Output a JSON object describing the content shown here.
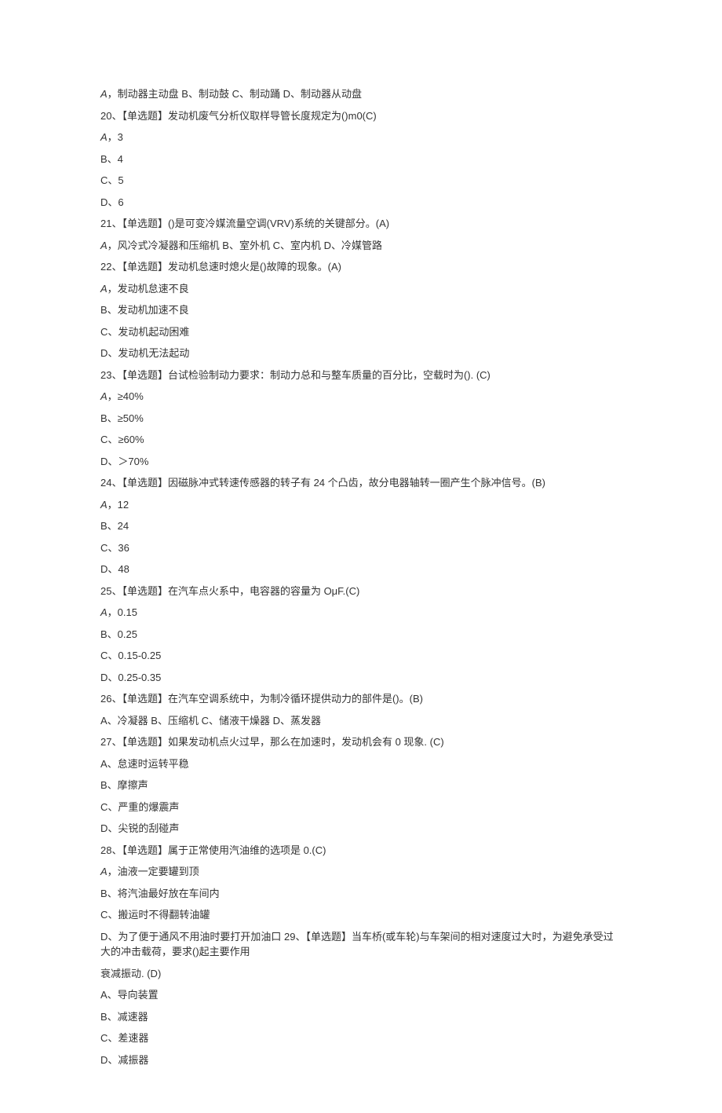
{
  "lines": [
    {
      "a_prefix": true,
      "text": "，制动器主动盘 B、制动鼓 C、制动踊 D、制动器从动盘"
    },
    {
      "text": "20、【单选题】发动机废气分析仪取样导管长度规定为()m0(C)"
    },
    {
      "a_prefix": true,
      "text": "，3"
    },
    {
      "text": "B、4"
    },
    {
      "text": "C、5"
    },
    {
      "text": "D、6"
    },
    {
      "text": "21、【单选题】()是可变冷媒流量空调(VRV)系统的关键部分。(A)"
    },
    {
      "a_prefix": true,
      "text": "，风冷式冷凝器和压缩机 B、室外机 C、室内机 D、冷媒管路"
    },
    {
      "text": "22、【单选题】发动机怠速时熄火是()故障的现象。(A)"
    },
    {
      "a_prefix": true,
      "text": "，发动机怠速不良"
    },
    {
      "text": "B、发动机加速不良"
    },
    {
      "text": "C、发动机起动困难"
    },
    {
      "text": "D、发动机无法起动"
    },
    {
      "text": "23、【单选题】台试检验制动力要求：制动力总和与整车质量的百分比，空载时为(). (C)"
    },
    {
      "a_prefix": true,
      "text": "，≥40%"
    },
    {
      "text": "B、≥50%"
    },
    {
      "text": "C、≥60%"
    },
    {
      "text": "D、＞70%"
    },
    {
      "text": "24、【单选题】因磁脉冲式转速传感器的转子有 24 个凸齿，故分电器轴转一圈产生个脉冲信号。(B)"
    },
    {
      "a_prefix": true,
      "text": "，12"
    },
    {
      "text": "B、24"
    },
    {
      "text": "C、36"
    },
    {
      "text": "D、48"
    },
    {
      "text": "25、【单选题】在汽车点火系中，电容器的容量为 OμF.(C)"
    },
    {
      "a_prefix": true,
      "text": "，0.15"
    },
    {
      "text": "B、0.25"
    },
    {
      "text": "C、0.15-0.25"
    },
    {
      "text": "D、0.25-0.35"
    },
    {
      "text": "26、【单选题】在汽车空调系统中，为制冷循环提供动力的部件是()。(B)"
    },
    {
      "text": "A、冷凝器 B、压缩机 C、储液干燥器 D、蒸发器"
    },
    {
      "text": "27、【单选题】如果发动机点火过早，那么在加速时，发动机会有 0 现象. (C)"
    },
    {
      "text": "A、怠速时运转平稳"
    },
    {
      "text": "B、摩擦声"
    },
    {
      "text": "C、严重的爆震声"
    },
    {
      "text": "D、尖锐的刮碰声"
    },
    {
      "text": "28、【单选题】属于正常使用汽油维的选项是 0.(C)"
    },
    {
      "a_prefix": true,
      "text": "，油液一定要罐到顶"
    },
    {
      "text": "B、将汽油最好放在车间内"
    },
    {
      "text": "C、搬运时不得翻转油罐"
    },
    {
      "text": "D、为了便于通风不用油时要打开加油口 29、【单选题】当车桥(或车轮)与车架间的相对速度过大时，为避免承受过大的冲击载荷，要求()起主要作用"
    },
    {
      "text": "衰减振动. (D)"
    },
    {
      "text": "A、导向装置"
    },
    {
      "text": "B、减速器"
    },
    {
      "text": "C、差速器"
    },
    {
      "text": "D、减振器"
    }
  ]
}
